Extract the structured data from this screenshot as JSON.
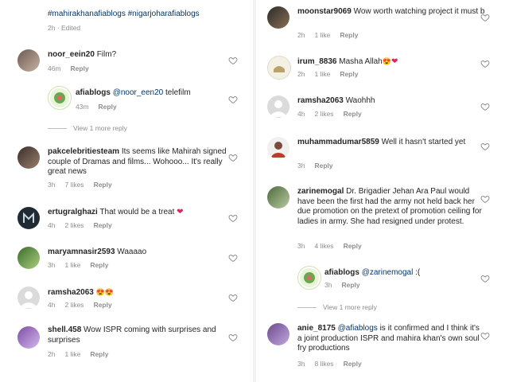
{
  "caption": {
    "hashtags": "#mahirakhanafiablogs #nigarjoharafiablogs",
    "meta": "2h · Edited"
  },
  "left": [
    {
      "user": "noor_eein20",
      "text": "Film?",
      "time": "46m",
      "likes": "",
      "reply": "Reply"
    },
    {
      "user": "afiablogs",
      "mention": "@noor_een20",
      "text": " telefilm",
      "time": "43m",
      "likes": "",
      "reply": "Reply"
    },
    {
      "view_more": "View 1 more reply"
    },
    {
      "user": "pakcelebritiesteam",
      "text": "Its seems like Mahirah signed couple of Dramas and films... Wohooo... It's really great news",
      "time": "3h",
      "likes": "7 likes",
      "reply": "Reply"
    },
    {
      "user": "ertugralghazi",
      "text": "That would be a treat",
      "time": "4h",
      "likes": "2 likes",
      "reply": "Reply"
    },
    {
      "user": "maryamnasir2593",
      "text": "Waaaao",
      "time": "3h",
      "likes": "1 like",
      "reply": "Reply"
    },
    {
      "user": "ramsha2063",
      "text": "",
      "time": "4h",
      "likes": "2 likes",
      "reply": "Reply"
    },
    {
      "user": "shell.458",
      "text": "Wow ISPR coming with surprises and surprises",
      "time": "2h",
      "likes": "1 like",
      "reply": "Reply"
    }
  ],
  "right": [
    {
      "user": "moonstar9069",
      "text": "Wow worth watching project it must b",
      "time": "2h",
      "likes": "1 like",
      "reply": "Reply"
    },
    {
      "user": "irum_8836",
      "text": "Masha Allah",
      "time": "2h",
      "likes": "1 like",
      "reply": "Reply"
    },
    {
      "user": "ramsha2063",
      "text": "Waohhh",
      "time": "4h",
      "likes": "2 likes",
      "reply": "Reply"
    },
    {
      "user": "muhammadumar5859",
      "text": "Well it hasn't started yet",
      "time": "3h",
      "likes": "",
      "reply": "Reply"
    },
    {
      "user": "zarinemogal",
      "text": "Dr. Brigadier Jehan Ara Paul would have been the first had the army not held back her due promotion on the pretext of promotion ceiling for ladies in army. She had resigned under protest.",
      "time": "3h",
      "likes": "4 likes",
      "reply": "Reply"
    },
    {
      "user": "afiablogs",
      "mention": "@zarinemogal",
      "text": " :(",
      "time": "3h",
      "likes": "",
      "reply": "Reply"
    },
    {
      "view_more": "View 1 more reply"
    },
    {
      "user": "anie_8175",
      "mention": "@afiablogs",
      "text": " is it confirmed and I think it's a  joint production ISPR and mahira khan's own soul fry productions",
      "time": "3h",
      "likes": "8 likes",
      "reply": "Reply"
    }
  ],
  "colors": {
    "accent": "#00376b",
    "muted": "#8e8e8e",
    "heart_red": "#e0245e"
  }
}
